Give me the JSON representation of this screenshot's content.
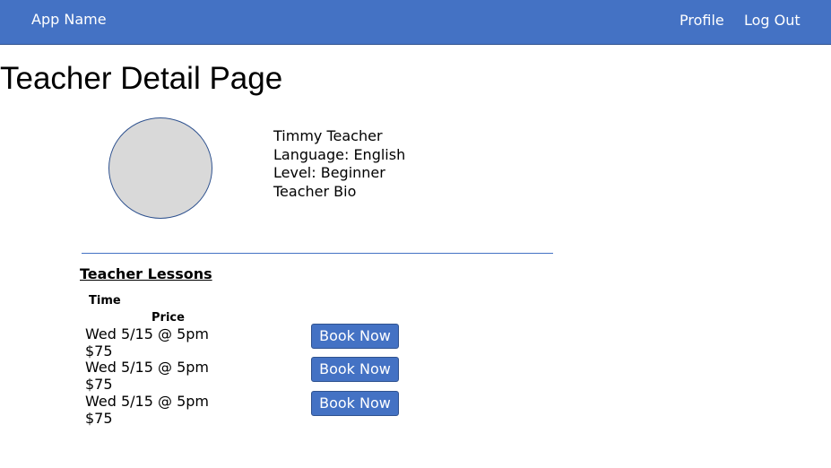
{
  "navbar": {
    "brand": "App Name",
    "links": [
      "Profile",
      "Log Out"
    ],
    "background": "#4472c4"
  },
  "page": {
    "title": "Teacher Detail Page"
  },
  "teacher": {
    "name": "Timmy Teacher",
    "language": "Language: English",
    "level": "Level: Beginner",
    "bio": "Teacher Bio"
  },
  "lessons": {
    "title": "Teacher Lessons",
    "columns": [
      "Time",
      "Price"
    ],
    "rows": [
      {
        "time": "Wed 5/15 @ 5pm",
        "price": "$75",
        "action": "Book Now"
      },
      {
        "time": "Wed 5/15 @ 5pm",
        "price": "$75",
        "action": "Book Now"
      },
      {
        "time": "Wed 5/15 @ 5pm",
        "price": "$75",
        "action": "Book Now"
      }
    ]
  }
}
